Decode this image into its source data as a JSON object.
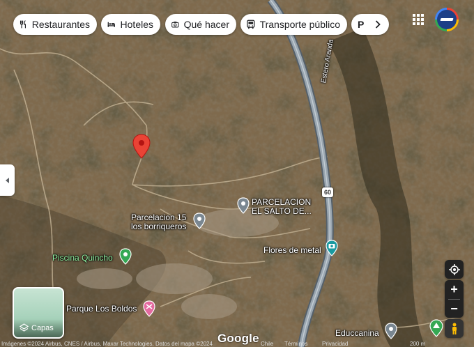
{
  "chips": [
    {
      "label": "Restaurantes",
      "icon": "fork-knife-icon"
    },
    {
      "label": "Hoteles",
      "icon": "bed-icon"
    },
    {
      "label": "Qué hacer",
      "icon": "camera-icon"
    },
    {
      "label": "Transporte público",
      "icon": "bus-icon"
    },
    {
      "label": "P",
      "icon": "chevron-right-icon"
    }
  ],
  "places": {
    "parcelacion_salto": "PARCELACION\nEL SALTO DE...",
    "parcelacion_15": "Parcelacion 15\nlos borriqueros",
    "flores_metal": "Flores de metal",
    "piscina": "Piscina Quincho",
    "parque": "Parque Los Boldos",
    "educcanina": "Educcanina",
    "estero": "Estero Aranda",
    "route": "60"
  },
  "layers": {
    "label": "Capas"
  },
  "brand": {
    "logo": "Google"
  },
  "footer": {
    "attribution": "Imágenes ©2024 Airbus, CNES / Airbus, Maxar Technologies, Datos del mapa ©2024",
    "country": "Chile",
    "terms": "Términos",
    "privacy": "Privacidad",
    "scale": "200 m"
  },
  "colors": {
    "pin_red": "#ea4335",
    "pin_gray": "#7a8791",
    "pin_teal": "#1a9aa0",
    "pin_green": "#34a853",
    "pin_pink": "#e46aa0"
  }
}
